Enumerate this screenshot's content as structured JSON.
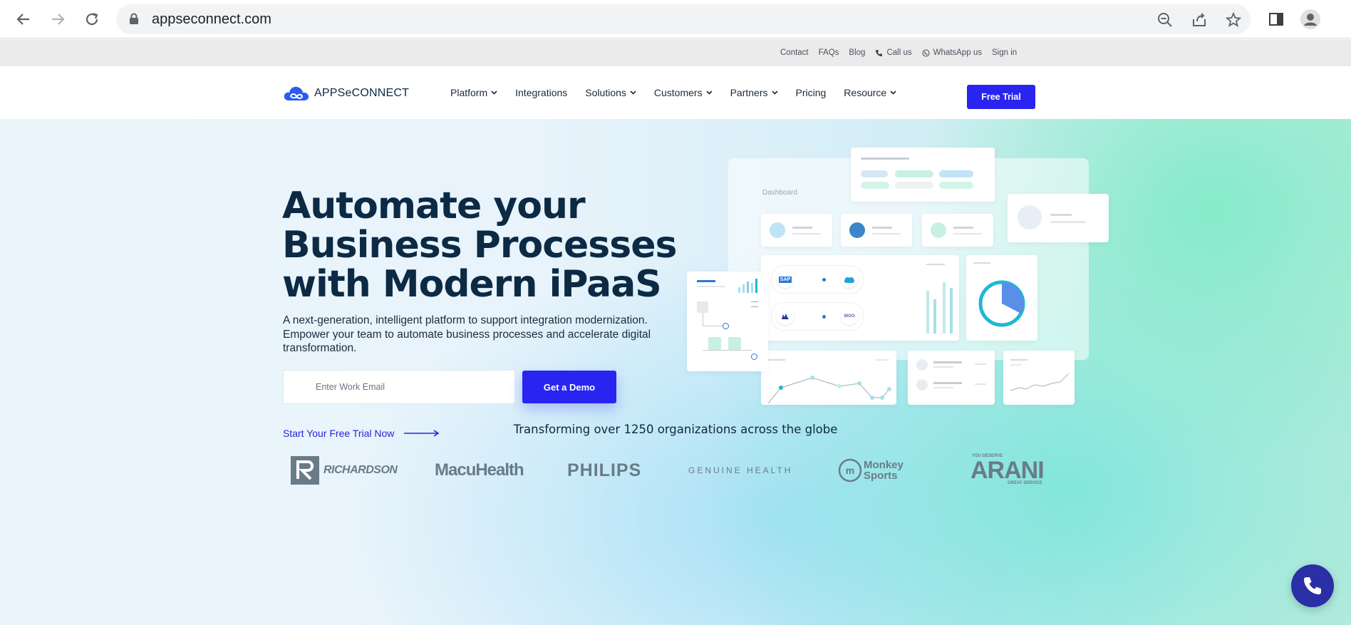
{
  "browser": {
    "url": "appseconnect.com"
  },
  "utility_bar": {
    "links": [
      "Contact",
      "FAQs",
      "Blog",
      "Call us",
      "WhatsApp us",
      "Sign in"
    ]
  },
  "nav": {
    "logo_text": "APPSeCONNECT",
    "menu": [
      {
        "label": "Platform",
        "dropdown": true
      },
      {
        "label": "Integrations",
        "dropdown": false
      },
      {
        "label": "Solutions",
        "dropdown": true
      },
      {
        "label": "Customers",
        "dropdown": true
      },
      {
        "label": "Partners",
        "dropdown": true
      },
      {
        "label": "Pricing",
        "dropdown": false
      },
      {
        "label": "Resource",
        "dropdown": true
      }
    ],
    "cta": "Free Trial"
  },
  "hero": {
    "headline_line1": "Automate your",
    "headline_line2": "Business Processes",
    "headline_line3": "with Modern iPaaS",
    "subtext": "A next-generation, intelligent platform to support integration modernization. Empower your team to automate business processes and accelerate digital transformation.",
    "email_placeholder": "Enter Work Email",
    "demo_button": "Get a Demo",
    "trial_link": "Start Your Free Trial Now",
    "dashboard_label": "Dashboard",
    "dashboard_logos": {
      "sap": "SAP",
      "woo": "WOO"
    }
  },
  "customers": {
    "tagline": "Transforming over 1250 organizations across the globe",
    "brands": [
      "RICHARDSON",
      "MacuHealth",
      "PHILIPS",
      "GENUINE HEALTH",
      "Monkey Sports",
      "ARANI"
    ],
    "arani_top": "YOU DESERVE",
    "arani_bottom": "GREAT SERVICE"
  },
  "colors": {
    "brand_blue": "#2a24f0",
    "headline": "#0c2a44",
    "call_button": "#2a2fa5"
  }
}
